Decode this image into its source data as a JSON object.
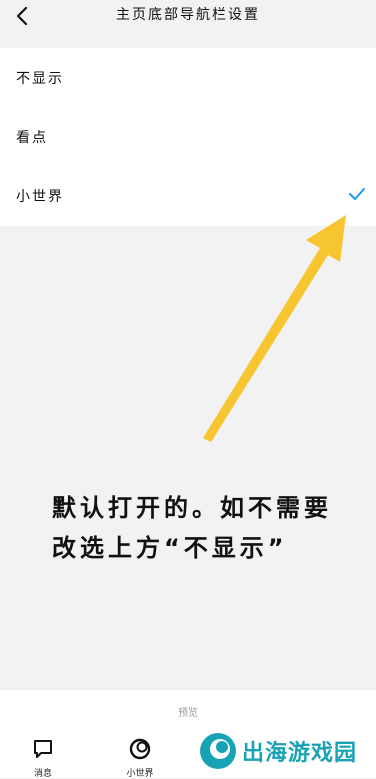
{
  "header": {
    "title": "主页底部导航栏设置"
  },
  "options": [
    {
      "label": "不显示",
      "selected": false
    },
    {
      "label": "看点",
      "selected": false
    },
    {
      "label": "小世界",
      "selected": true
    }
  ],
  "annotation": {
    "line1": "默认打开的。如不需要",
    "line2": "改选上方“不显示”"
  },
  "preview": {
    "label": "预览",
    "nav": [
      {
        "label": "消息",
        "icon": "chat-icon"
      },
      {
        "label": "小世界",
        "icon": "circle-icon"
      }
    ]
  },
  "watermark": {
    "text": "出海游戏园"
  },
  "colors": {
    "check": "#1a9be6",
    "arrow": "#f7c530",
    "watermark": "#18a3b4"
  }
}
